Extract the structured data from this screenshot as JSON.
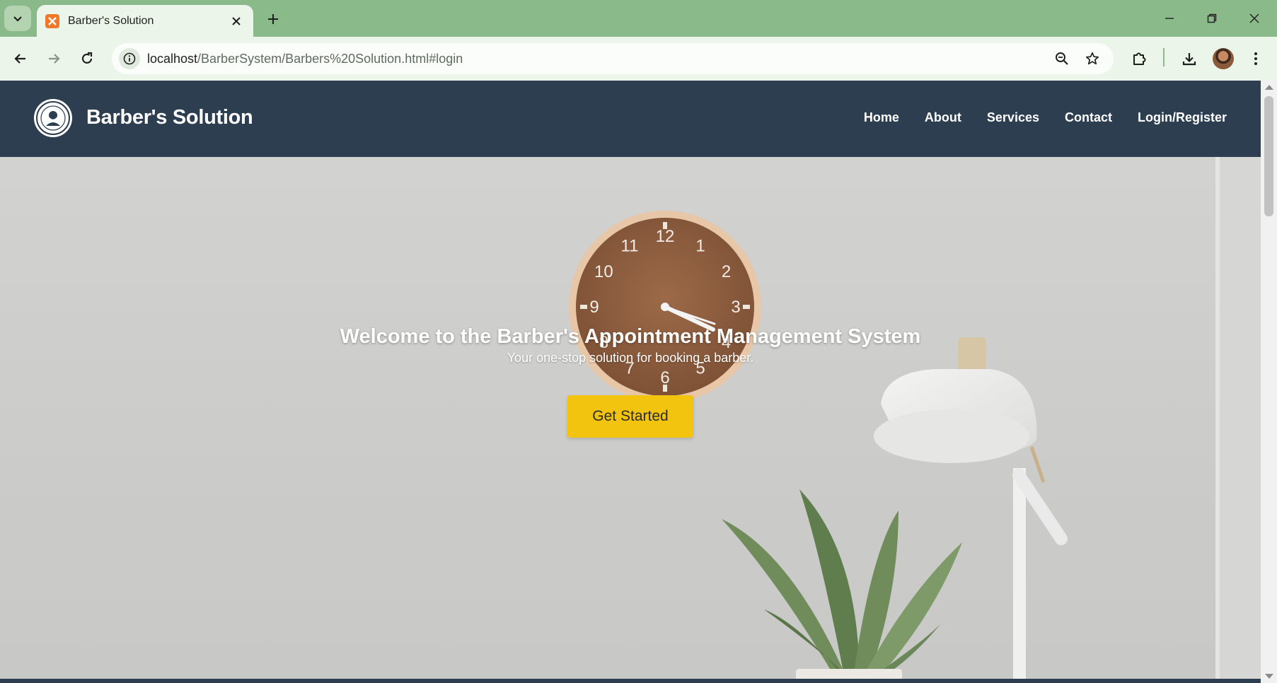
{
  "browser": {
    "tab_title": "Barber's Solution",
    "url_host": "localhost",
    "url_path": "/BarberSystem/Barbers%20Solution.html#login"
  },
  "site": {
    "brand": "Barber's Solution",
    "nav": [
      "Home",
      "About",
      "Services",
      "Contact",
      "Login/Register"
    ]
  },
  "hero": {
    "title": "Welcome to the Barber's Appointment Management System",
    "subtitle": "Your one-stop solution for booking a barber.",
    "cta_label": "Get Started"
  },
  "clock": {
    "numbers": [
      "12",
      "1",
      "2",
      "3",
      "4",
      "5",
      "6",
      "7",
      "8",
      "9",
      "10",
      "11"
    ]
  },
  "colors": {
    "header_bg": "#2c3e50",
    "cta_bg": "#f2c40f",
    "chrome_tabstrip": "#8aba8a",
    "chrome_toolbar": "#ecf5ea"
  },
  "icons": {
    "tab_search": "chevron-down-icon",
    "back": "arrow-left-icon",
    "forward": "arrow-right-icon",
    "reload": "reload-icon",
    "site_info": "info-icon",
    "zoom": "zoom-out-icon",
    "bookmark": "star-icon",
    "extensions": "puzzle-icon",
    "downloads": "download-icon",
    "menu": "kebab-menu-icon"
  }
}
